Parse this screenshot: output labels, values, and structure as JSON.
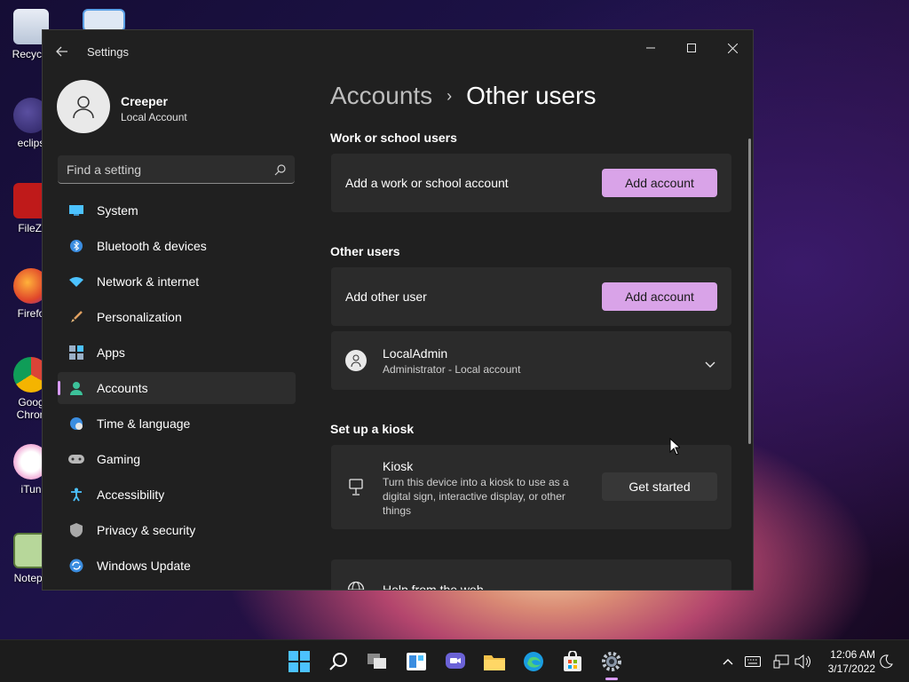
{
  "desktop": {
    "icons": [
      {
        "label": "Recycle"
      },
      {
        "label": ""
      },
      {
        "label": "eclips"
      },
      {
        "label": "FileZi"
      },
      {
        "label": "Firefo"
      },
      {
        "label": "Goog Chron"
      },
      {
        "label": "iTun"
      },
      {
        "label": "Notepa"
      }
    ]
  },
  "window": {
    "title": "Settings",
    "profile": {
      "name": "Creeper",
      "subtitle": "Local Account"
    },
    "search": {
      "placeholder": "Find a setting"
    },
    "nav": [
      {
        "label": "System",
        "icon": "monitor-icon",
        "active": false
      },
      {
        "label": "Bluetooth & devices",
        "icon": "bluetooth-icon",
        "active": false
      },
      {
        "label": "Network & internet",
        "icon": "wifi-icon",
        "active": false
      },
      {
        "label": "Personalization",
        "icon": "brush-icon",
        "active": false
      },
      {
        "label": "Apps",
        "icon": "apps-icon",
        "active": false
      },
      {
        "label": "Accounts",
        "icon": "person-icon",
        "active": true
      },
      {
        "label": "Time & language",
        "icon": "globe-clock-icon",
        "active": false
      },
      {
        "label": "Gaming",
        "icon": "gamepad-icon",
        "active": false
      },
      {
        "label": "Accessibility",
        "icon": "accessibility-icon",
        "active": false
      },
      {
        "label": "Privacy & security",
        "icon": "shield-icon",
        "active": false
      },
      {
        "label": "Windows Update",
        "icon": "update-icon",
        "active": false
      }
    ],
    "breadcrumb": {
      "parent": "Accounts",
      "separator": "›",
      "current": "Other users"
    },
    "work_school": {
      "heading": "Work or school users",
      "row_label": "Add a work or school account",
      "button": "Add account"
    },
    "other_users": {
      "heading": "Other users",
      "row_label": "Add other user",
      "button": "Add account",
      "user": {
        "name": "LocalAdmin",
        "detail": "Administrator - Local account"
      }
    },
    "kiosk": {
      "heading": "Set up a kiosk",
      "title": "Kiosk",
      "description_lines": [
        "Turn this device into a kiosk to use as a",
        "digital sign, interactive display, or other",
        "things"
      ],
      "button": "Get started"
    },
    "help": {
      "title": "Help from the web"
    }
  },
  "taskbar": {
    "apps": [
      "start-icon",
      "search-icon",
      "task-view-icon",
      "widgets-icon",
      "chat-icon",
      "file-explorer-icon",
      "edge-icon",
      "store-icon",
      "settings-icon"
    ],
    "clock": {
      "time": "12:06 AM",
      "date": "3/17/2022"
    }
  },
  "colors": {
    "accent": "#d9a3e8",
    "window_bg": "#202020",
    "card_bg": "#2b2b2b"
  }
}
